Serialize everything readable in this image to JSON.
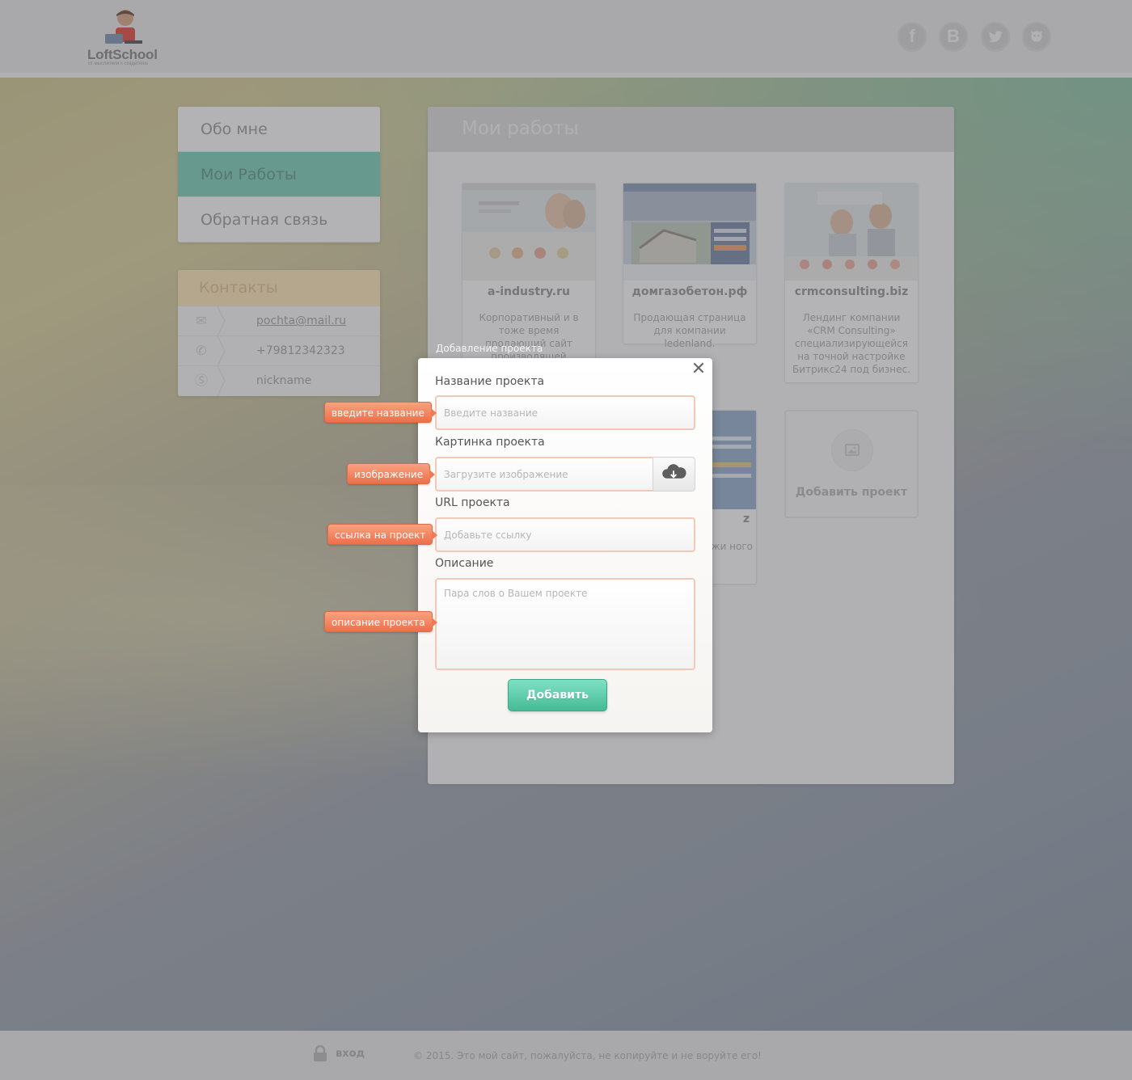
{
  "header": {
    "logo_text": "LoftSchool",
    "logo_subtitle": "от мыслителя к создателю",
    "socials": [
      {
        "icon": "facebook-icon",
        "glyph": "f"
      },
      {
        "icon": "vk-icon",
        "glyph": "B"
      },
      {
        "icon": "twitter-icon",
        "glyph": "🐦"
      },
      {
        "icon": "github-icon",
        "glyph": "🐙"
      }
    ]
  },
  "nav": {
    "items": [
      {
        "label": "Обо мне"
      },
      {
        "label": "Мои Работы"
      },
      {
        "label": "Обратная связь"
      }
    ]
  },
  "contacts": {
    "title": "Контакты",
    "email": "pochta@mail.ru",
    "phone": "+79812342323",
    "skype": "nickname"
  },
  "works": {
    "title": "Мои работы",
    "cards": [
      {
        "title": "a-industry.ru",
        "description": "Корпоративный и в тоже время продающий сайт производящей компании a-industry"
      },
      {
        "title": "домгазобетон.рф",
        "description": "Продающая страница для компании ledenland."
      },
      {
        "title": "crmconsulting.biz",
        "description": "Лендинг компании «CRM Consulting» специализирующейся на точной настройке Битрикс24 под бизнес."
      }
    ],
    "partial_card": {
      "title_fragment": "z",
      "description": "продажи ного"
    },
    "add_label": "Добавить проект"
  },
  "modal": {
    "caption": "Добавление проекта",
    "close_glyph": "✕",
    "name_label": "Название проекта",
    "name_placeholder": "Введите название",
    "image_label": "Картинка проекта",
    "image_placeholder": "Загрузите изображение",
    "url_label": "URL проекта",
    "url_placeholder": "Добавьте ссылку",
    "desc_label": "Описание",
    "desc_placeholder": "Пара слов о Вашем проекте",
    "submit": "Добавить"
  },
  "tooltips": {
    "name": "введите название",
    "image": "изображение",
    "url": "ссылка на проект",
    "desc": "описание проекта"
  },
  "footer": {
    "login": "вход",
    "copyright": "© 2015. Это мой сайт, пожалуйста, не копируйте и не воруйте его!"
  }
}
